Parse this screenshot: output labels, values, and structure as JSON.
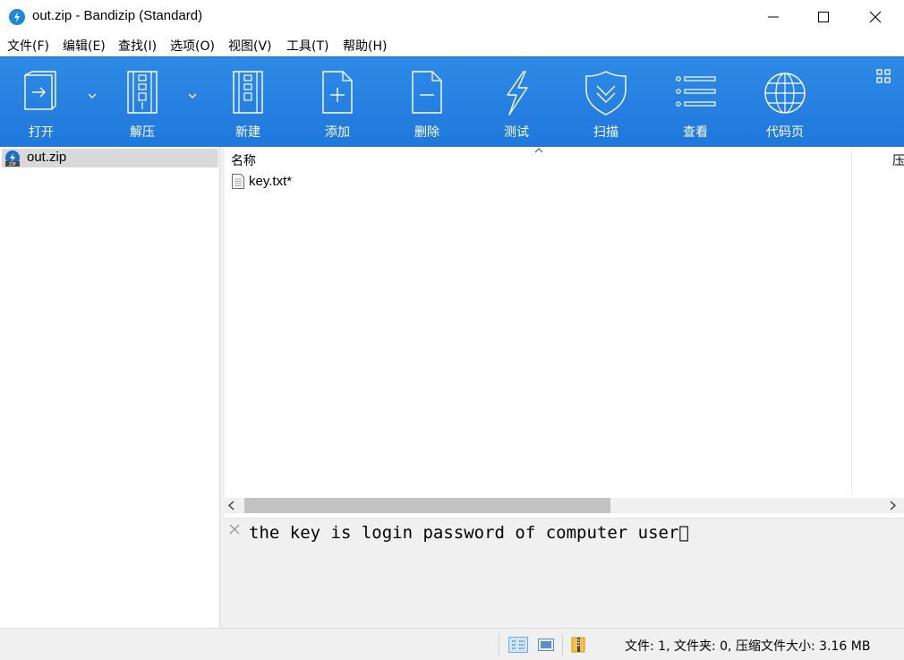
{
  "window": {
    "title": "out.zip - Bandizip (Standard)",
    "icon": "bandizip-logo-icon"
  },
  "menu": [
    {
      "label": "文件(F)"
    },
    {
      "label": "编辑(E)"
    },
    {
      "label": "查找(I)"
    },
    {
      "label": "选项(O)"
    },
    {
      "label": "视图(V)"
    },
    {
      "label": "工具(T)"
    },
    {
      "label": "帮助(H)"
    }
  ],
  "toolbar": {
    "accent": "#2483e2",
    "buttons": [
      {
        "label": "打开",
        "icon": "open-icon"
      },
      {
        "label": "解压",
        "icon": "extract-icon"
      },
      {
        "label": "新建",
        "icon": "new-archive-icon"
      },
      {
        "label": "添加",
        "icon": "add-icon"
      },
      {
        "label": "删除",
        "icon": "delete-icon"
      },
      {
        "label": "测试",
        "icon": "test-icon"
      },
      {
        "label": "扫描",
        "icon": "scan-icon"
      },
      {
        "label": "查看",
        "icon": "view-icon"
      },
      {
        "label": "代码页",
        "icon": "codepage-icon"
      }
    ]
  },
  "tree": {
    "items": [
      {
        "label": "out.zip",
        "selected": true
      }
    ]
  },
  "list": {
    "columns": {
      "name": "名称",
      "compressed": "压"
    },
    "files": [
      {
        "name": "key.txt*"
      }
    ]
  },
  "comment": {
    "text": "the key is login password of computer user\u0000"
  },
  "status": {
    "summary": "文件: 1, 文件夹: 0, 压缩文件大小: 3.16 MB"
  }
}
